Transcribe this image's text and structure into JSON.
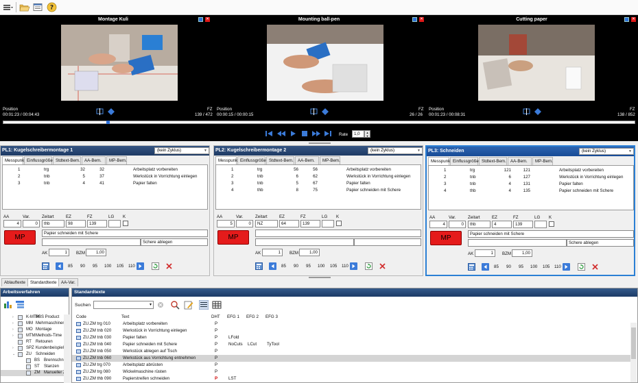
{
  "videos": [
    {
      "title": "Montage Kuli",
      "position_label": "Position",
      "time": "00:01:23 / 00:04:43",
      "fz_label": "FZ",
      "frames": "139 / 472"
    },
    {
      "title": "Mounting ball-pen",
      "position_label": "Position",
      "time": "00:00:15 / 00:00:15",
      "fz_label": "FZ",
      "frames": "26 / 26"
    },
    {
      "title": "Cutting paper",
      "position_label": "Position",
      "time": "00:01:23 / 00:08:31",
      "fz_label": "FZ",
      "frames": "138 / 852"
    }
  ],
  "close_glyph": "✕",
  "playback": {
    "rate_label": "Rate",
    "rate_value": "1,0",
    "progress_fraction": 0.163
  },
  "panel_tabs": [
    "Messpunkte",
    "Einflussgrößen",
    "Stdtext-Bem.",
    "AA-Bem.",
    "MP-Bem."
  ],
  "field_labels": {
    "aa": "AA",
    "var": "Var.",
    "zeitart": "Zeitart",
    "ez": "EZ",
    "fz": "FZ",
    "lg": "LG",
    "k": "K",
    "ak": "AK",
    "bzm": "BZM"
  },
  "mp_label": "MP",
  "percentages": [
    "85",
    "90",
    "95",
    "100",
    "105",
    "110"
  ],
  "panels": [
    {
      "title": "PL1: Kugelschreibermontage 1",
      "zyklus": "(kein Zyklus)",
      "rows": [
        {
          "nr": "1",
          "za": "trg",
          "ez": "32",
          "fz": "32",
          "text": "Arbeitsplatz vorbereiten"
        },
        {
          "nr": "2",
          "za": "tnb",
          "ez": "5",
          "fz": "37",
          "text": "Werkstück in Vorrichtung einlegen"
        },
        {
          "nr": "3",
          "za": "tnb",
          "ez": "4",
          "fz": "41",
          "text": "Papier falten"
        }
      ],
      "aa": "4",
      "var": "0",
      "zeitart": "thb",
      "ez": "98",
      "fz": "139",
      "lg": "",
      "text1": "Papier schneiden mit Schere",
      "text2": "",
      "text3": "Schere ablegen",
      "ak": "1",
      "bzm": "1,00"
    },
    {
      "title": "PL2: Kugelschreibermontage 2",
      "zyklus": "(kein Zyklus)",
      "rows": [
        {
          "nr": "1",
          "za": "trg",
          "ez": "56",
          "fz": "56",
          "text": "Arbeitsplatz vorbereiten"
        },
        {
          "nr": "2",
          "za": "tnb",
          "ez": "6",
          "fz": "62",
          "text": "Werkstück in Vorrichtung einlegen"
        },
        {
          "nr": "3",
          "za": "tnb",
          "ez": "5",
          "fz": "67",
          "text": "Papier falten"
        },
        {
          "nr": "4",
          "za": "thb",
          "ez": "8",
          "fz": "75",
          "text": "Papier schneiden mit Schere"
        }
      ],
      "aa": "5",
      "var": "0",
      "zeitart": "NZ",
      "ez": "64",
      "fz": "139",
      "lg": "",
      "text1": "",
      "text2": "",
      "text3": "",
      "ak": "1",
      "bzm": "1,00"
    },
    {
      "title": "PL3: Schneiden",
      "zyklus": "(kein Zyklus)",
      "rows": [
        {
          "nr": "1",
          "za": "trg",
          "ez": "121",
          "fz": "121",
          "text": "Arbeitsplatz vorbereiten"
        },
        {
          "nr": "2",
          "za": "tnb",
          "ez": "6",
          "fz": "127",
          "text": "Werkstück in Vorrichtung einlegen"
        },
        {
          "nr": "3",
          "za": "tnb",
          "ez": "4",
          "fz": "131",
          "text": "Papier falten"
        },
        {
          "nr": "4",
          "za": "thb",
          "ez": "4",
          "fz": "135",
          "text": "Papier schneiden mit Schere"
        }
      ],
      "aa": "4",
      "var": "0",
      "zeitart": "thb",
      "ez": "4",
      "fz": "139",
      "lg": "",
      "text1": "Papier schneiden mit Schere",
      "text2": "",
      "text3": "Schere ablegen",
      "ak": "1",
      "bzm": "1,00"
    }
  ],
  "lower_tabs": [
    "Ablauftexte",
    "Standardtexte",
    "AA-Var."
  ],
  "left_pane": {
    "title": "Arbeitsverfahren",
    "tree": [
      {
        "code": "K-MTM",
        "label": "PBS Product",
        "level": 0,
        "expander": "›"
      },
      {
        "code": "MM",
        "label": "Mehrmaschinenl",
        "level": 0,
        "expander": "›"
      },
      {
        "code": "MO",
        "label": "Montage",
        "level": 0,
        "expander": "›"
      },
      {
        "code": "MTM",
        "label": "Methods-Time",
        "level": 0,
        "expander": "›"
      },
      {
        "code": "RT",
        "label": "Retouren",
        "level": 0,
        "expander": ""
      },
      {
        "code": "SPZ",
        "label": "Kundenbeispiel",
        "level": 0,
        "expander": "›"
      },
      {
        "code": "ZU",
        "label": "Schneiden",
        "level": 0,
        "expander": "⌄"
      },
      {
        "code": "BS",
        "label": "Brennschneid",
        "level": 1,
        "expander": ""
      },
      {
        "code": "ST",
        "label": "Stanzen",
        "level": 1,
        "expander": ""
      },
      {
        "code": "ZM",
        "label": "Manueller Zu",
        "level": 1,
        "expander": ""
      }
    ]
  },
  "right_pane": {
    "title": "Standardtexte",
    "search_label": "Suchen",
    "columns": [
      "Code",
      "Text",
      "DHT",
      "EFG 1",
      "EFG 2",
      "EFG 3"
    ],
    "rows": [
      {
        "code": "ZU.ZM trg 010",
        "text": "Arbeitsplatz vorbereiten",
        "dht": "P",
        "efg1": "",
        "efg2": "",
        "efg3": ""
      },
      {
        "code": "ZU.ZM tnb 020",
        "text": "Werkstück in Vorrichtung einlegen",
        "dht": "P",
        "efg1": "",
        "efg2": "",
        "efg3": ""
      },
      {
        "code": "ZU.ZM tnb 030",
        "text": "Papier falten",
        "dht": "P",
        "efg1": "LFold",
        "efg2": "",
        "efg3": ""
      },
      {
        "code": "ZU.ZM tnb 040",
        "text": "Papier schneiden mit Schere",
        "dht": "P",
        "efg1": "NoCuts",
        "efg2": "LCut",
        "efg3": "TyTool"
      },
      {
        "code": "ZU.ZM tnb 050",
        "text": "Werkstück ablegen auf Tisch",
        "dht": "P",
        "efg1": "",
        "efg2": "",
        "efg3": ""
      },
      {
        "code": "ZU.ZM tnb 060",
        "text": "Werkstück aus Vorrichtung entnehmen",
        "dht": "P",
        "efg1": "",
        "efg2": "",
        "efg3": ""
      },
      {
        "code": "ZU.ZM trg 070",
        "text": "Arbeitsplatz abrüsten",
        "dht": "P",
        "efg1": "",
        "efg2": "",
        "efg3": ""
      },
      {
        "code": "ZU.ZM trg 080",
        "text": "Wickelmaschine rüsten",
        "dht": "P",
        "efg1": "",
        "efg2": "",
        "efg3": ""
      },
      {
        "code": "ZU.ZM thb 090",
        "text": "Papierstreifen schneiden",
        "dht": "P",
        "efg1": "LST",
        "efg2": "",
        "efg3": ""
      }
    ]
  },
  "colors": {
    "header_dark": "#1e3a64",
    "selected_border": "#2a7fd4",
    "mp_red": "#e51b1b",
    "accent_blue": "#3b7bd9",
    "dht_red": "#d00000"
  }
}
